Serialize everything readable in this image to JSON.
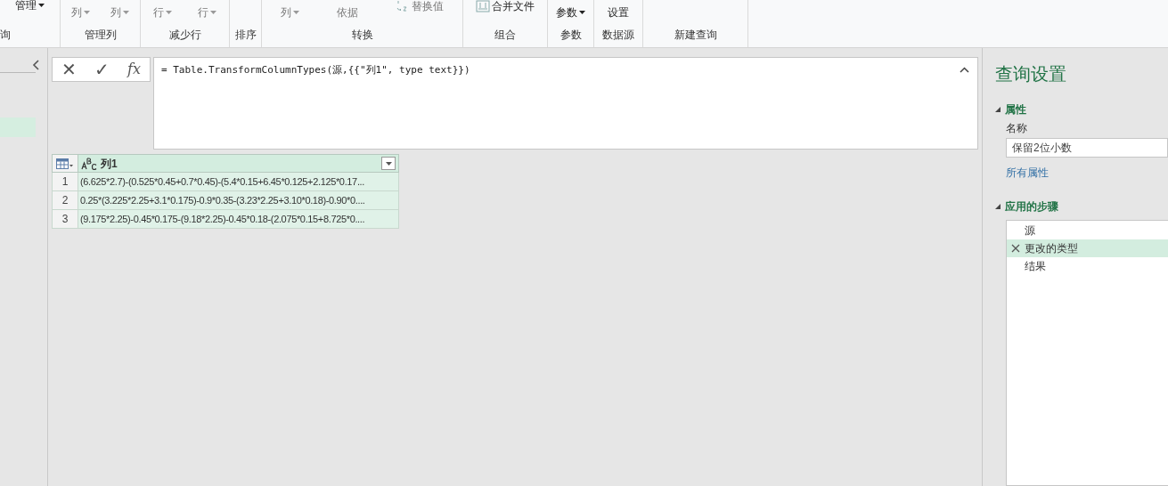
{
  "ribbon": {
    "groups": [
      {
        "label": "询",
        "items": [
          {
            "text": "管理",
            "kind": "small",
            "dropdown": true
          }
        ]
      },
      {
        "label": "管理列",
        "items": [
          {
            "text": "列",
            "kind": "large",
            "dropdown": true
          },
          {
            "text": "列",
            "kind": "large",
            "dropdown": true
          }
        ]
      },
      {
        "label": "减少行",
        "items": [
          {
            "text": "行",
            "kind": "large",
            "dropdown": true
          },
          {
            "text": "行",
            "kind": "large",
            "dropdown": true
          }
        ]
      },
      {
        "label": "排序"
      },
      {
        "label": "转换",
        "items": [
          {
            "text": "列",
            "kind": "large",
            "dropdown": true
          },
          {
            "text": "依据",
            "kind": "large",
            "dropdown": false
          },
          {
            "text": "替换值",
            "kind": "replace",
            "dropdown": false
          }
        ]
      },
      {
        "label": "组合",
        "items": [
          {
            "text": "合并文件",
            "kind": "combine",
            "dropdown": false
          }
        ]
      },
      {
        "label": "参数",
        "items": [
          {
            "text": "参数",
            "kind": "large",
            "dropdown": true
          }
        ]
      },
      {
        "label": "数据源",
        "items": [
          {
            "text": "设置",
            "kind": "large",
            "dropdown": false
          }
        ]
      },
      {
        "label": "新建查询"
      }
    ]
  },
  "formula_bar": {
    "cancel": "✕",
    "confirm": "✓",
    "fx": "fx",
    "formula": "= Table.TransformColumnTypes(源,{{\"列1\", type text}})"
  },
  "table": {
    "columns": [
      {
        "name": "列1"
      }
    ],
    "rows": [
      {
        "number": "1",
        "cells": [
          "(6.625*2.7)-(0.525*0.45+0.7*0.45)-(5.4*0.15+6.45*0.125+2.125*0.17..."
        ]
      },
      {
        "number": "2",
        "cells": [
          "0.25*(3.225*2.25+3.1*0.175)-0.9*0.35-(3.23*2.25+3.10*0.18)-0.90*0...."
        ]
      },
      {
        "number": "3",
        "cells": [
          "(9.175*2.25)-0.45*0.175-(9.18*2.25)-0.45*0.18-(2.075*0.15+8.725*0...."
        ]
      }
    ]
  },
  "query_settings": {
    "title": "查询设置",
    "properties": {
      "heading": "属性",
      "name_label": "名称",
      "name_value": "保留2位小数",
      "all_properties_link": "所有属性"
    },
    "steps_heading": "应用的步骤",
    "steps": [
      {
        "label": "源",
        "selected": false
      },
      {
        "label": "更改的类型",
        "selected": true
      },
      {
        "label": "结果",
        "selected": false
      }
    ]
  }
}
